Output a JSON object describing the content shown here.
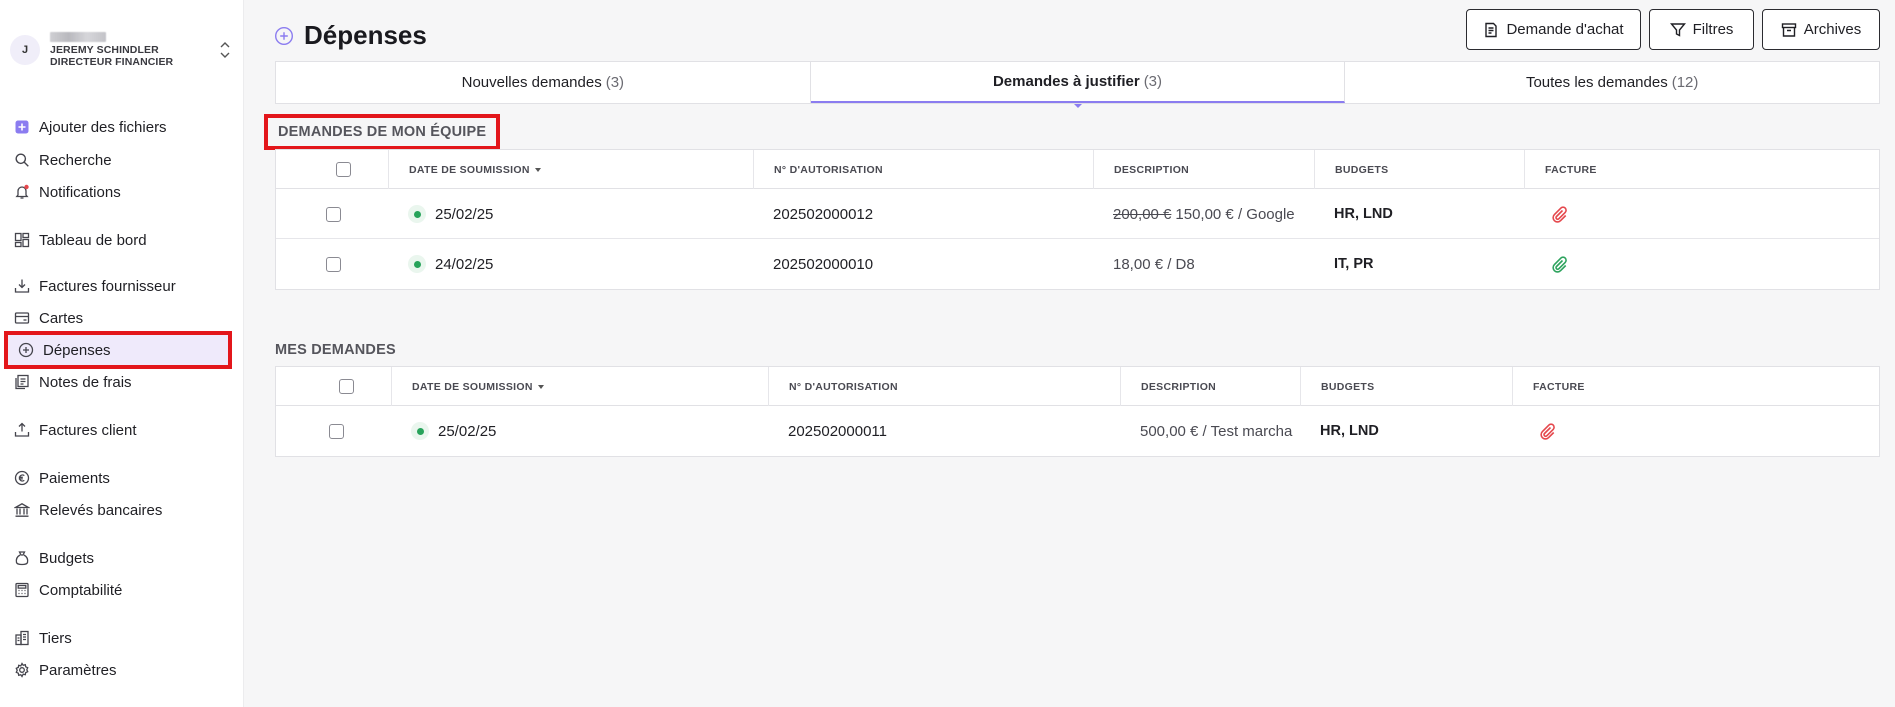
{
  "user": {
    "initial": "J",
    "name": "JEREMY SCHINDLER",
    "role": "DIRECTEUR FINANCIER"
  },
  "sidebar": {
    "items": [
      {
        "label": "Ajouter des fichiers",
        "icon": "add-file-icon"
      },
      {
        "label": "Recherche",
        "icon": "search-icon"
      },
      {
        "label": "Notifications",
        "icon": "bell-icon"
      },
      {
        "label": "Tableau de bord",
        "icon": "dashboard-icon"
      },
      {
        "label": "Factures fournisseur",
        "icon": "download-tray-icon"
      },
      {
        "label": "Cartes",
        "icon": "card-icon"
      },
      {
        "label": "Dépenses",
        "icon": "plus-circle-icon"
      },
      {
        "label": "Notes de frais",
        "icon": "receipt-icon"
      },
      {
        "label": "Factures client",
        "icon": "upload-tray-icon"
      },
      {
        "label": "Paiements",
        "icon": "euro-icon"
      },
      {
        "label": "Relevés bancaires",
        "icon": "bank-icon"
      },
      {
        "label": "Budgets",
        "icon": "money-bag-icon"
      },
      {
        "label": "Comptabilité",
        "icon": "calculator-icon"
      },
      {
        "label": "Tiers",
        "icon": "buildings-icon"
      },
      {
        "label": "Paramètres",
        "icon": "gear-icon"
      }
    ]
  },
  "header": {
    "title": "Dépenses",
    "buttons": {
      "purchase": "Demande d'achat",
      "filters": "Filtres",
      "archives": "Archives"
    }
  },
  "tabs": [
    {
      "label": "Nouvelles demandes",
      "count": "(3)"
    },
    {
      "label": "Demandes à justifier",
      "count": "(3)"
    },
    {
      "label": "Toutes les demandes",
      "count": "(12)"
    }
  ],
  "team": {
    "label": "DEMANDES DE MON ÉQUIPE",
    "columns": [
      "DATE DE SOUMISSION",
      "N° D'AUTORISATION",
      "DESCRIPTION",
      "BUDGETS",
      "FACTURE"
    ],
    "rows": [
      {
        "date": "25/02/25",
        "auth": "202502000012",
        "desc_old": "200,00 €",
        "desc": "150,00 € / Google",
        "budgets": "HR, LND",
        "invoice_color": "#e5484d"
      },
      {
        "date": "24/02/25",
        "auth": "202502000010",
        "desc_old": "",
        "desc": "18,00 € / D8",
        "budgets": "IT, PR",
        "invoice_color": "#2ea35e"
      }
    ]
  },
  "mine": {
    "label": "MES DEMANDES",
    "columns": [
      "DATE DE SOUMISSION",
      "N° D'AUTORISATION",
      "DESCRIPTION",
      "BUDGETS",
      "FACTURE"
    ],
    "rows": [
      {
        "date": "25/02/25",
        "auth": "202502000011",
        "desc": "500,00 € / Test marcha",
        "budgets": "HR, LND",
        "invoice_color": "#e5484d"
      }
    ]
  },
  "colors": {
    "accent": "#8b7cf0",
    "highlight": "#e3161b",
    "status_green": "#28a35b"
  }
}
